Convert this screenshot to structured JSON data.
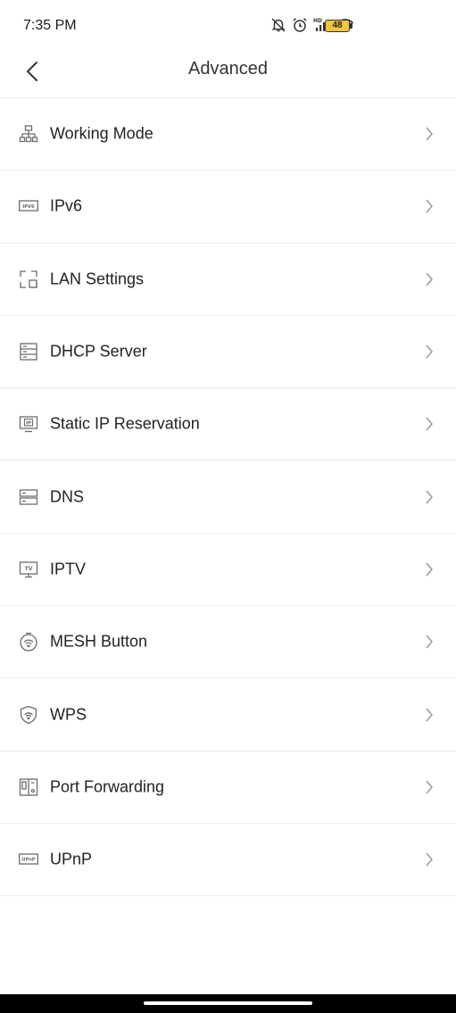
{
  "status_bar": {
    "time": "7:35 PM",
    "battery": "48",
    "icons": [
      "bell-off-icon",
      "alarm-icon",
      "hd-signal-icon",
      "wifi-icon",
      "battery-icon"
    ]
  },
  "header": {
    "title": "Advanced",
    "back_icon": "back-chevron-icon"
  },
  "menu": {
    "items": [
      {
        "label": "Working Mode",
        "icon": "network-topology-icon"
      },
      {
        "label": "IPv6",
        "icon": "ipv6-icon",
        "icon_text": "IPV6"
      },
      {
        "label": "LAN Settings",
        "icon": "lan-icon"
      },
      {
        "label": "DHCP Server",
        "icon": "server-icon"
      },
      {
        "label": "Static IP Reservation",
        "icon": "ip-monitor-icon",
        "icon_text": "IP"
      },
      {
        "label": "DNS",
        "icon": "dns-server-icon"
      },
      {
        "label": "IPTV",
        "icon": "tv-icon",
        "icon_text": "TV"
      },
      {
        "label": "MESH Button",
        "icon": "mesh-wifi-icon"
      },
      {
        "label": "WPS",
        "icon": "shield-wifi-icon"
      },
      {
        "label": "Port Forwarding",
        "icon": "port-forwarding-icon"
      },
      {
        "label": "UPnP",
        "icon": "upnp-icon",
        "icon_text": "UPnP"
      }
    ]
  },
  "colors": {
    "text": "#222222",
    "icon": "#6b6b6b",
    "divider": "#ececec",
    "battery": "#f2c53d"
  }
}
